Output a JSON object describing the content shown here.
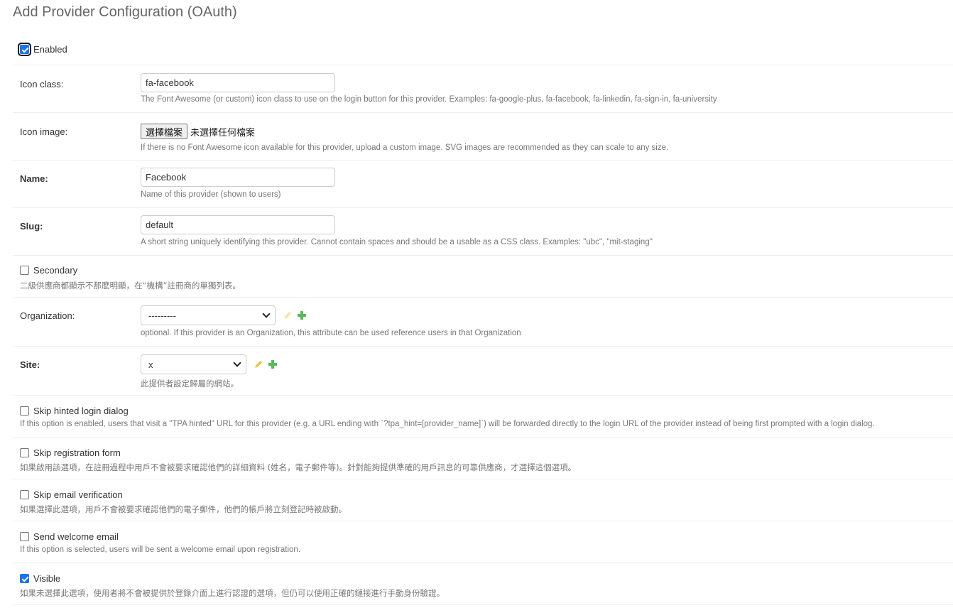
{
  "page": {
    "title": "Add Provider Configuration (OAuth)"
  },
  "enabled": {
    "label": "Enabled",
    "checked": true
  },
  "icon_class": {
    "label": "Icon class:",
    "value": "fa-facebook",
    "help": "The Font Awesome (or custom) icon class to use on the login button for this provider. Examples: fa-google-plus, fa-facebook, fa-linkedin, fa-sign-in, fa-university"
  },
  "icon_image": {
    "label": "Icon image:",
    "button_label": "選擇檔案",
    "status": "未選擇任何檔案",
    "help": "If there is no Font Awesome icon available for this provider, upload a custom image. SVG images are recommended as they can scale to any size."
  },
  "name": {
    "label": "Name:",
    "value": "Facebook",
    "help": "Name of this provider (shown to users)"
  },
  "slug": {
    "label": "Slug:",
    "value": "default",
    "help": "A short string uniquely identifying this provider. Cannot contain spaces and should be a usable as a CSS class. Examples: \"ubc\", \"mit-staging\""
  },
  "secondary": {
    "label": "Secondary",
    "checked": false,
    "help": "二級供應商都顯示不那麽明顯，在“機構”註冊商的單獨列表。"
  },
  "organization": {
    "label": "Organization:",
    "selected": "---------",
    "help": "optional. If this provider is an Organization, this attribute can be used reference users in that Organization"
  },
  "site": {
    "label": "Site:",
    "selected": "x",
    "help": "此提供者設定歸屬的網站。"
  },
  "skip_hinted_login": {
    "label": "Skip hinted login dialog",
    "checked": false,
    "help": "If this option is enabled, users that visit a \"TPA hinted\" URL for this provider (e.g. a URL ending with `?tpa_hint=[provider_name]`) will be forwarded directly to the login URL of the provider instead of being first prompted with a login dialog."
  },
  "skip_registration": {
    "label": "Skip registration form",
    "checked": false,
    "help": "如果啟用該選項，在註冊過程中用戶不會被要求確認他們的詳細資料 (姓名，電子郵件等)。針對能夠提供準確的用戶訊息的可靠供應商，才選擇這個選項。"
  },
  "skip_email_verification": {
    "label": "Skip email verification",
    "checked": false,
    "help": "如果選擇此選項，用戶不會被要求確認他們的電子郵件，他們的帳戶將立刻登記時被啟動。"
  },
  "send_welcome_email": {
    "label": "Send welcome email",
    "checked": false,
    "help": "If this option is selected, users will be sent a welcome email upon registration."
  },
  "visible": {
    "label": "Visible",
    "checked": true,
    "help": "如果未選擇此選項，使用者將不會被提供於登錄介面上進行認證的選項，但仍可以使用正確的鏈接進行手動身份驗證。"
  },
  "colors": {
    "checkbox_checked": "#1a73e8",
    "add_icon": "#5bb75b",
    "edit_icon_active": "#e8c640",
    "edit_icon_disabled": "#f3e6a8",
    "help_text": "#777777",
    "title_text": "#666666"
  }
}
